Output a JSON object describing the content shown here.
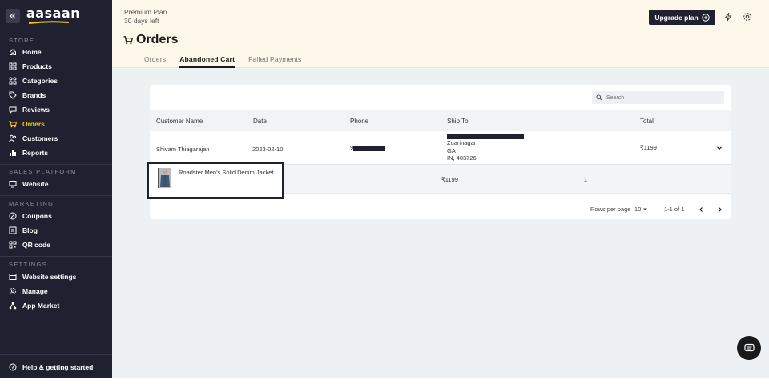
{
  "brand": {
    "logo_text": "aasaan"
  },
  "sidebar": {
    "sections": [
      {
        "label": "STORE",
        "items": [
          {
            "label": "Home",
            "icon": "home-icon"
          },
          {
            "label": "Products",
            "icon": "grid-icon"
          },
          {
            "label": "Categories",
            "icon": "categories-icon"
          },
          {
            "label": "Brands",
            "icon": "tag-icon"
          },
          {
            "label": "Reviews",
            "icon": "reviews-icon"
          },
          {
            "label": "Orders",
            "icon": "cart-icon",
            "active": true
          },
          {
            "label": "Customers",
            "icon": "users-icon"
          },
          {
            "label": "Reports",
            "icon": "chart-icon"
          }
        ]
      },
      {
        "label": "SALES PLATFORM",
        "items": [
          {
            "label": "Website",
            "icon": "monitor-icon"
          }
        ]
      },
      {
        "label": "MARKETING",
        "items": [
          {
            "label": "Coupons",
            "icon": "coupon-icon"
          },
          {
            "label": "Blog",
            "icon": "blog-icon"
          },
          {
            "label": "QR code",
            "icon": "qr-icon"
          }
        ]
      },
      {
        "label": "SETTINGS",
        "items": [
          {
            "label": "Website settings",
            "icon": "website-settings-icon"
          },
          {
            "label": "Manage",
            "icon": "gear-icon"
          },
          {
            "label": "App Market",
            "icon": "apps-icon"
          }
        ]
      }
    ],
    "help_label": "Help & getting started"
  },
  "header": {
    "plan_name": "Premium Plan",
    "plan_days": "30 days left",
    "title": "Orders",
    "upgrade_label": "Upgrade plan",
    "tabs": [
      "Orders",
      "Abandoned Cart",
      "Failed Payments"
    ],
    "active_tab": "Abandoned Cart"
  },
  "table": {
    "search_placeholder": "Search",
    "columns": [
      "Customer Name",
      "Date",
      "Phone",
      "Ship To",
      "Total"
    ],
    "rows": [
      {
        "customer": "Shivam Thiagarajan",
        "date": "2023-02-10",
        "phone_prefix": "9",
        "ship_to": [
          "Zuarinagar",
          "GA",
          "IN, 403726"
        ],
        "total": "₹1199",
        "items": [
          {
            "name": "Roadster Men's Solid Denim Jacket",
            "price": "₹1199",
            "qty": "1"
          }
        ]
      }
    ],
    "pagination": {
      "rows_per_page_label": "Rows per page",
      "rows_per_page": "10",
      "range": "1-1 of 1"
    }
  },
  "colors": {
    "sidebar_bg": "#1f2130",
    "active_item": "#f5c518",
    "header_bg": "#fdf8ea",
    "main_bg": "#eef1f4"
  }
}
